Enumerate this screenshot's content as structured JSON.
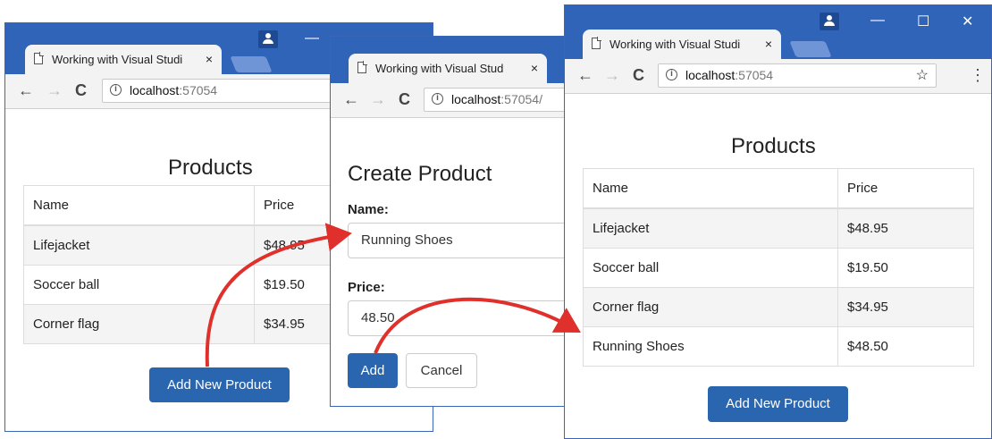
{
  "window1": {
    "tab_title": "Working with Visual Studi",
    "tab_close": "×",
    "address_host": "localhost",
    "address_port": ":57054",
    "heading": "Products",
    "table": {
      "headers": [
        "Name",
        "Price"
      ],
      "rows": [
        [
          "Lifejacket",
          "$48.95"
        ],
        [
          "Soccer ball",
          "$19.50"
        ],
        [
          "Corner flag",
          "$34.95"
        ]
      ]
    },
    "add_button": "Add New Product"
  },
  "window2": {
    "tab_title": "Working with Visual Stud",
    "tab_close": "×",
    "address_host": "localhost",
    "address_port": ":57054/",
    "heading": "Create Product",
    "name_label": "Name:",
    "name_value": "Running Shoes",
    "price_label": "Price:",
    "price_value": "48.50",
    "add_button": "Add",
    "cancel_button": "Cancel"
  },
  "window3": {
    "tab_title": "Working with Visual Studi",
    "tab_close": "×",
    "address_host": "localhost",
    "address_port": ":57054",
    "heading": "Products",
    "table": {
      "headers": [
        "Name",
        "Price"
      ],
      "rows": [
        [
          "Lifejacket",
          "$48.95"
        ],
        [
          "Soccer ball",
          "$19.50"
        ],
        [
          "Corner flag",
          "$34.95"
        ],
        [
          "Running Shoes",
          "$48.50"
        ]
      ]
    },
    "add_button": "Add New Product"
  },
  "icons": {
    "back": "←",
    "forward": "→",
    "reload": "C",
    "info": "i",
    "star": "☆",
    "menu": "⋮",
    "minimize": "—",
    "maximize": "☐",
    "close": "✕"
  },
  "colors": {
    "titlebar": "#2f64b8",
    "button": "#2a66b0",
    "arrow": "#e0302c"
  }
}
